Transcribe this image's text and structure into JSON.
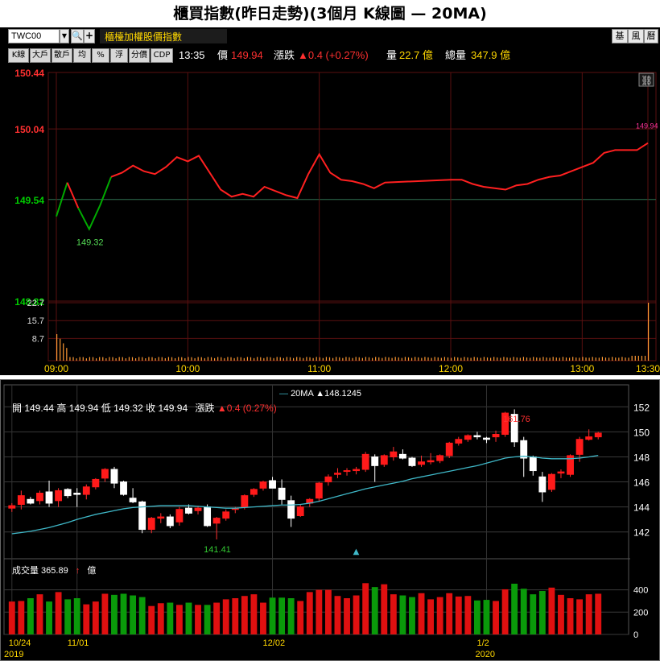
{
  "title": "櫃買指數(昨日走勢)(3個月 K線圖 — 20MA)",
  "toolbar": {
    "symbol": "TWC00",
    "index_name": "櫃檯加權股價指數",
    "right_buttons": [
      "基",
      "風",
      "曆"
    ],
    "buttons": [
      "K線",
      "大戶",
      "散戶",
      "均",
      "%",
      "浮",
      "分價",
      "CDP"
    ]
  },
  "quote": {
    "time": "13:35",
    "price_label": "價",
    "price": "149.94",
    "change_label": "漲跌",
    "change": "▲0.4 (+0.27%)",
    "vol_label": "量",
    "vol": "22.7 億",
    "total_label": "總量",
    "total": "347.9 億"
  },
  "colors": {
    "up": "#ff2020",
    "down": "#00aa00",
    "ma": "#3fb8c8",
    "vol_intraday": "#ff9933",
    "grid": "#5a1010"
  },
  "intraday": {
    "y_ticks": [
      "150.44",
      "150.04",
      "149.54",
      "148.82"
    ],
    "vol_ticks": [
      "22.7",
      "15.7",
      "8.7"
    ],
    "x_ticks": [
      "09:00",
      "10:00",
      "11:00",
      "12:00",
      "13:00",
      "13:30"
    ],
    "reference_price": 149.54,
    "low_label": "149.32",
    "last_label": "149.94",
    "chart_data": {
      "type": "line",
      "xlabel": "",
      "ylabel": "",
      "ylim": [
        148.82,
        150.44
      ],
      "x": [
        "09:00",
        "09:05",
        "09:10",
        "09:15",
        "09:20",
        "09:25",
        "09:30",
        "09:35",
        "09:40",
        "09:45",
        "09:50",
        "09:55",
        "10:00",
        "10:05",
        "10:10",
        "10:15",
        "10:20",
        "10:25",
        "10:30",
        "10:35",
        "10:40",
        "10:45",
        "10:50",
        "10:55",
        "11:00",
        "11:05",
        "11:10",
        "11:15",
        "11:20",
        "11:25",
        "11:30",
        "12:00",
        "12:05",
        "12:10",
        "12:15",
        "12:20",
        "12:25",
        "12:30",
        "12:35",
        "12:40",
        "12:45",
        "12:50",
        "12:55",
        "13:00",
        "13:05",
        "13:10",
        "13:15",
        "13:20",
        "13:25",
        "13:30"
      ],
      "values": [
        149.42,
        149.66,
        149.48,
        149.33,
        149.5,
        149.7,
        149.73,
        149.78,
        149.74,
        149.72,
        149.77,
        149.84,
        149.81,
        149.85,
        149.73,
        149.61,
        149.56,
        149.58,
        149.56,
        149.63,
        149.6,
        149.57,
        149.55,
        149.72,
        149.86,
        149.73,
        149.68,
        149.67,
        149.65,
        149.62,
        149.66,
        149.68,
        149.68,
        149.65,
        149.63,
        149.62,
        149.61,
        149.64,
        149.65,
        149.68,
        149.7,
        149.71,
        149.74,
        149.77,
        149.8,
        149.87,
        149.89,
        149.89,
        149.89,
        149.94
      ]
    },
    "volume_chart": {
      "type": "bar",
      "ylim": [
        0,
        22.7
      ],
      "first_bar": 10.4,
      "typical_bar": 1.2,
      "last_bar": 22.7
    }
  },
  "daily": {
    "legend_label": "20MA",
    "legend_value": "▲148.1245",
    "ohlc_text": "開 149.44  高 149.94  低 149.32  收 149.94",
    "chg_label": "漲跌",
    "chg_value": "▲0.4 (0.27%)",
    "high_label": "161.76",
    "low_label": "141.41",
    "y_ticks": [
      "152",
      "150",
      "148",
      "146",
      "144",
      "142"
    ],
    "vol_header": "成交量 365.89",
    "vol_unit": "億",
    "vol_arrow": "↑",
    "vol_ticks": [
      "400",
      "200",
      "0"
    ],
    "x_ticks": [
      "10/24",
      "11/01",
      "12/02",
      "1/2"
    ],
    "year_ticks": [
      "2019",
      "2020"
    ],
    "chart_data": {
      "type": "candlestick",
      "xlabel": "",
      "ylabel": "",
      "ylim": [
        140.5,
        153.5
      ],
      "candles": [
        [
          143.9,
          144.3,
          143.6,
          144.1,
          295
        ],
        [
          144.2,
          145.3,
          143.8,
          144.9,
          300
        ],
        [
          144.6,
          144.8,
          144.2,
          144.3,
          325
        ],
        [
          144.5,
          145.3,
          144.2,
          145.1,
          360
        ],
        [
          145.2,
          146.1,
          144.0,
          144.3,
          295
        ],
        [
          144.5,
          145.5,
          144.0,
          145.3,
          380
        ],
        [
          145.4,
          145.5,
          144.7,
          144.9,
          315
        ],
        [
          145.1,
          145.5,
          144.0,
          145.0,
          325
        ],
        [
          145.0,
          145.8,
          144.6,
          145.6,
          270
        ],
        [
          145.6,
          146.3,
          145.4,
          146.2,
          295
        ],
        [
          146.3,
          147.1,
          146.0,
          147.0,
          365
        ],
        [
          147.0,
          147.2,
          145.5,
          145.9,
          355
        ],
        [
          146.0,
          146.1,
          144.9,
          145.0,
          365
        ],
        [
          144.7,
          145.5,
          144.3,
          144.4,
          350
        ],
        [
          144.4,
          144.5,
          141.9,
          142.2,
          335
        ],
        [
          142.2,
          143.2,
          141.9,
          143.1,
          255
        ],
        [
          143.1,
          143.5,
          142.7,
          143.2,
          280
        ],
        [
          143.2,
          143.4,
          142.3,
          142.5,
          285
        ],
        [
          142.8,
          144.0,
          142.5,
          143.8,
          265
        ],
        [
          143.9,
          144.2,
          143.4,
          143.5,
          285
        ],
        [
          143.7,
          144.1,
          143.4,
          143.9,
          265
        ],
        [
          144.0,
          144.2,
          142.4,
          142.5,
          265
        ],
        [
          142.7,
          143.2,
          141.4,
          143.1,
          285
        ],
        [
          143.1,
          143.8,
          142.9,
          143.6,
          315
        ],
        [
          143.8,
          144.0,
          143.5,
          143.9,
          325
        ],
        [
          144.0,
          145.0,
          143.8,
          144.9,
          345
        ],
        [
          145.0,
          145.5,
          144.8,
          145.4,
          360
        ],
        [
          145.5,
          146.1,
          145.3,
          146.0,
          285
        ],
        [
          146.1,
          146.4,
          145.6,
          145.5,
          330
        ],
        [
          145.5,
          146.2,
          144.2,
          144.6,
          330
        ],
        [
          144.5,
          144.9,
          142.4,
          143.1,
          325
        ],
        [
          143.3,
          144.2,
          143.2,
          144.0,
          300
        ],
        [
          144.3,
          144.7,
          144.0,
          144.6,
          380
        ],
        [
          144.7,
          146.0,
          144.4,
          145.9,
          400
        ],
        [
          146.0,
          146.6,
          145.7,
          146.4,
          400
        ],
        [
          146.6,
          147.1,
          146.3,
          146.7,
          345
        ],
        [
          146.9,
          147.1,
          146.5,
          146.9,
          325
        ],
        [
          146.9,
          147.2,
          146.6,
          147.0,
          350
        ],
        [
          147.0,
          148.4,
          146.8,
          148.2,
          460
        ],
        [
          148.0,
          148.2,
          146.0,
          147.3,
          425
        ],
        [
          147.4,
          148.2,
          147.2,
          148.1,
          450
        ],
        [
          148.0,
          148.8,
          147.7,
          148.4,
          360
        ],
        [
          148.2,
          148.6,
          147.8,
          147.9,
          350
        ],
        [
          147.9,
          148.0,
          147.2,
          147.3,
          335
        ],
        [
          147.4,
          148.1,
          147.2,
          147.6,
          370
        ],
        [
          147.6,
          148.3,
          147.4,
          147.7,
          315
        ],
        [
          147.7,
          148.2,
          147.5,
          148.1,
          335
        ],
        [
          148.1,
          149.2,
          147.9,
          149.1,
          370
        ],
        [
          149.1,
          149.6,
          148.9,
          149.4,
          340
        ],
        [
          149.4,
          149.8,
          149.2,
          149.7,
          345
        ],
        [
          149.7,
          150.0,
          149.4,
          149.6,
          305
        ],
        [
          149.5,
          149.6,
          149.1,
          149.4,
          310
        ],
        [
          149.6,
          150.1,
          149.2,
          149.8,
          300
        ],
        [
          149.8,
          151.6,
          149.6,
          151.5,
          405
        ],
        [
          151.4,
          151.8,
          148.8,
          149.2,
          455
        ],
        [
          149.3,
          149.6,
          146.4,
          147.9,
          410
        ],
        [
          148.0,
          148.1,
          146.5,
          146.9,
          360
        ],
        [
          146.4,
          146.8,
          144.4,
          145.2,
          390
        ],
        [
          145.4,
          146.7,
          145.2,
          146.6,
          420
        ],
        [
          146.7,
          147.0,
          146.3,
          146.8,
          355
        ],
        [
          146.6,
          148.2,
          146.4,
          148.1,
          325
        ],
        [
          148.2,
          149.6,
          147.6,
          149.4,
          315
        ],
        [
          149.4,
          150.2,
          149.3,
          149.6,
          360
        ],
        [
          149.6,
          150.0,
          149.4,
          149.9,
          365
        ]
      ],
      "ma20": [
        141.85,
        141.95,
        142.05,
        142.2,
        142.35,
        142.55,
        142.75,
        143.0,
        143.2,
        143.4,
        143.55,
        143.7,
        143.85,
        143.95,
        144.0,
        144.05,
        144.1,
        144.1,
        144.1,
        144.1,
        144.05,
        144.0,
        143.95,
        143.9,
        143.9,
        143.95,
        144.0,
        144.05,
        144.1,
        144.15,
        144.15,
        144.2,
        144.3,
        144.45,
        144.65,
        144.85,
        145.05,
        145.25,
        145.45,
        145.6,
        145.75,
        145.9,
        146.05,
        146.25,
        146.4,
        146.55,
        146.7,
        146.85,
        147.0,
        147.15,
        147.3,
        147.5,
        147.7,
        147.9,
        148.0,
        148.05,
        148.0,
        147.9,
        147.85,
        147.85,
        147.85,
        147.9,
        148.0,
        148.12
      ]
    }
  }
}
